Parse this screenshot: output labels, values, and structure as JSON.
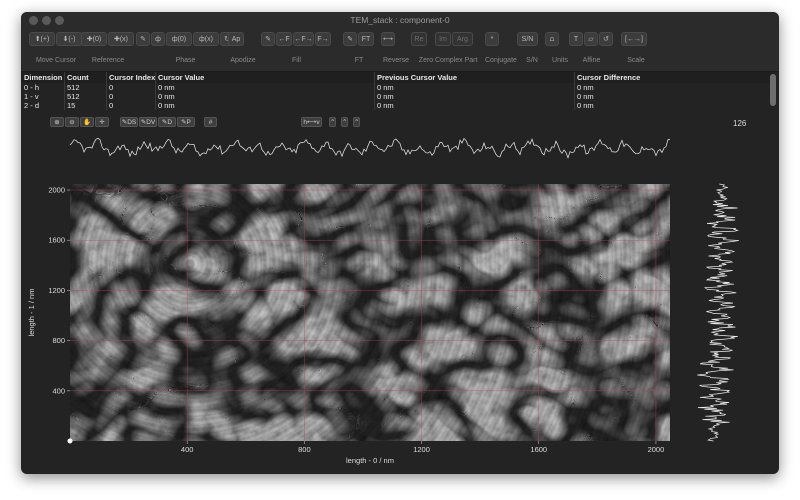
{
  "window": {
    "title": "TEM_stack : component-0"
  },
  "toolbar": {
    "groups": [
      {
        "label": "Move Cursor",
        "buttons": [
          "⬆(+)",
          "⬇(-)"
        ]
      },
      {
        "label": "Reference",
        "buttons": [
          "✚(0)",
          "✚(x)"
        ]
      },
      {
        "label": "Phase",
        "buttons": [
          "✎",
          "ф",
          "ф(0)",
          "ф(x)",
          "↻"
        ]
      },
      {
        "label": "Apodize",
        "buttons": [
          "Ap"
        ]
      },
      {
        "label": "Fill",
        "buttons": [
          "✎",
          "←F",
          "←F→",
          "F→"
        ]
      },
      {
        "label": "FT",
        "buttons": [
          "✎",
          "FT"
        ]
      },
      {
        "label": "Reverse",
        "buttons": [
          "⟷"
        ]
      },
      {
        "label": "Zero",
        "buttons": [
          "Re"
        ]
      },
      {
        "label": "Complex Part",
        "buttons": [
          "Im",
          "Arg"
        ]
      },
      {
        "label": "Conjugate",
        "buttons": [
          "*"
        ]
      },
      {
        "label": "S/N",
        "buttons": [
          "S/N"
        ]
      },
      {
        "label": "Units",
        "buttons": [
          "⩍"
        ]
      },
      {
        "label": "Affine",
        "buttons": [
          "T",
          "▱",
          "↺"
        ]
      },
      {
        "label": "Scale",
        "buttons": [
          "[←→]"
        ]
      }
    ]
  },
  "table": {
    "headers": [
      "Dimension",
      "Count",
      "Cursor Index",
      "Cursor Value",
      "Previous Cursor Value",
      "Cursor Difference"
    ],
    "rows": [
      [
        "0 - h",
        "512",
        "0",
        "0 nm",
        "0 nm",
        "0 nm"
      ],
      [
        "1 - v",
        "512",
        "0",
        "0 nm",
        "0 nm",
        "0 nm"
      ],
      [
        "2 - d",
        "15",
        "0",
        "0 nm",
        "0 nm",
        "0 nm"
      ]
    ]
  },
  "controls": {
    "left": [
      "⊕",
      "⊖",
      "✋",
      "✛"
    ],
    "view": [
      "✎DS",
      "✎DV",
      "✎D",
      "✎P"
    ],
    "grid": "#",
    "flip": "h⟷v",
    "steppers": [
      "⌃⌄",
      "⌃⌄",
      "⌃⌄"
    ],
    "slice_index": "126"
  },
  "plot": {
    "x_label": "length - 0 / nm",
    "y_label": "length - 1 / nm",
    "x_ticks": [
      "400",
      "800",
      "1200",
      "1600",
      "2000"
    ],
    "y_ticks": [
      "400",
      "800",
      "1200",
      "1600",
      "2000"
    ],
    "x_range": [
      0,
      2048
    ],
    "y_range": [
      0,
      2048
    ],
    "grid_color": "#c0405c"
  },
  "colors": {
    "window_bg": "#232323",
    "toolbar_bg": "#2b2b2b",
    "trace": "#f0f0f0"
  }
}
